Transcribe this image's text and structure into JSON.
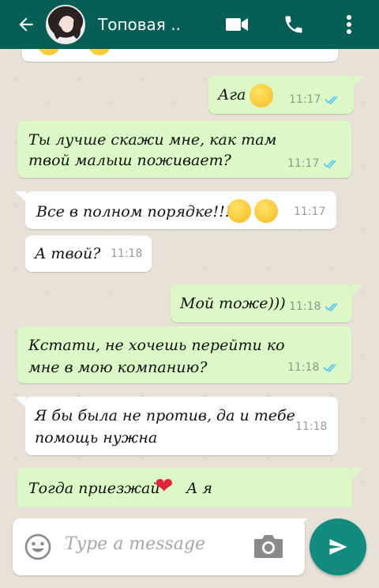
{
  "header": {
    "contact_name": "Топовая ..",
    "icons": [
      "back-arrow-icon",
      "video-call-icon",
      "phone-icon",
      "more-vert-icon"
    ]
  },
  "messages": [
    {
      "direction": "out",
      "text": "Ага",
      "emoji": "smirk",
      "time": "11:17",
      "read": true
    },
    {
      "direction": "out",
      "text_line1": "Ты лучше скажи мне, как там",
      "text_line2": "твой малыш поживает?",
      "time": "11:17",
      "read": true
    },
    {
      "direction": "in",
      "text": "Все в полном порядке!!!",
      "emoji": "grin, blush",
      "time": "11:17"
    },
    {
      "direction": "in",
      "text": "А твой?",
      "time": "11:18"
    },
    {
      "direction": "out",
      "text": "Мой тоже)))",
      "time": "11:18",
      "read": true
    },
    {
      "direction": "out",
      "text_line1": "Кстати, не хочешь перейти ко",
      "text_line2": "мне в мою компанию?",
      "time": "11:18",
      "read": true
    },
    {
      "direction": "in",
      "text_line1": "Я бы была не против, да и тебе",
      "text_line2": "помощь нужна",
      "time": "11:18"
    },
    {
      "direction": "out",
      "text": "Тогда приезжай",
      "text_after": "А я",
      "emoji": "red-heart"
    }
  ],
  "input": {
    "placeholder": "Type a message"
  },
  "colors": {
    "header": "#075e54",
    "outgoing_bubble": "#dcf8c6",
    "incoming_bubble": "#ffffff",
    "send_button": "#128c7e",
    "read_ticks": "#4fc3f7"
  }
}
